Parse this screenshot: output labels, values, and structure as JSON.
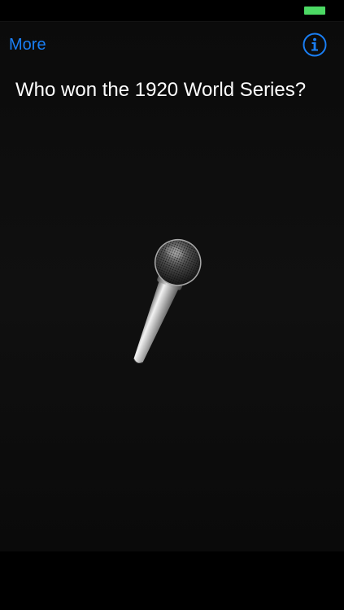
{
  "status_bar": {
    "battery_color": "#4cd964"
  },
  "nav": {
    "more_label": "More",
    "info_icon": "info-circle-icon",
    "accent_color": "#1a7ff5"
  },
  "question": {
    "text": "Who won the 1920 World Series?"
  },
  "microphone": {
    "icon": "microphone-icon"
  }
}
